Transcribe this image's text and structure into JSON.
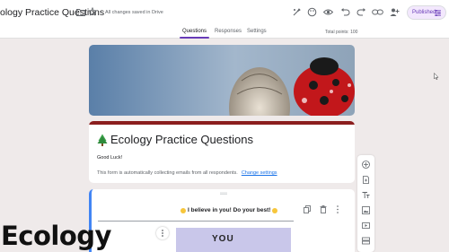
{
  "header": {
    "title": "ology Practice Questions",
    "saved_status": "All changes saved in Drive",
    "publish_label": "Published"
  },
  "tabs": [
    {
      "label": "Questions",
      "active": true
    },
    {
      "label": "Responses",
      "active": false
    },
    {
      "label": "Settings",
      "active": false
    }
  ],
  "total_points": "Total points: 100",
  "form": {
    "title": "Ecology Practice Questions",
    "description": "Good Luck!",
    "collecting_note": "This form is automatically collecting emails from all respondents.",
    "change_settings_link": "Change settings"
  },
  "question": {
    "text": "I believe in you! Do your best!",
    "image_caption": "YOU"
  },
  "overlay_caption": "Ecology",
  "colors": {
    "accent": "#673ab7",
    "header_band": "#8b1e1e",
    "link": "#1a73e8",
    "active_border": "#4285f4"
  }
}
